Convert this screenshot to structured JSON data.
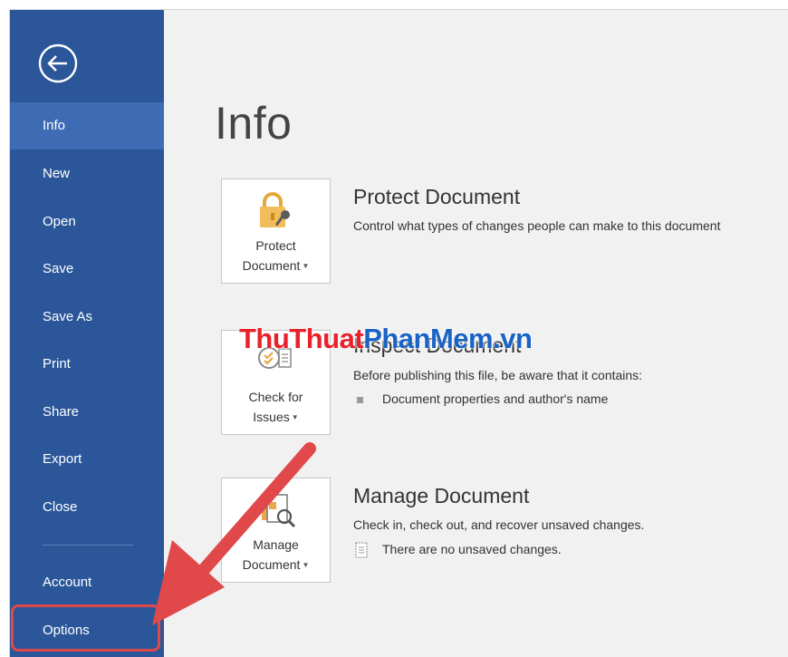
{
  "sidebar": {
    "items": [
      {
        "label": "Info"
      },
      {
        "label": "New"
      },
      {
        "label": "Open"
      },
      {
        "label": "Save"
      },
      {
        "label": "Save As"
      },
      {
        "label": "Print"
      },
      {
        "label": "Share"
      },
      {
        "label": "Export"
      },
      {
        "label": "Close"
      },
      {
        "label": "Account"
      },
      {
        "label": "Options"
      }
    ],
    "active": "Info",
    "highlighted": "Options"
  },
  "page_title": "Info",
  "sections": {
    "protect": {
      "tile_line1": "Protect",
      "tile_line2": "Document",
      "title": "Protect Document",
      "description": "Control what types of changes people can make to this document"
    },
    "inspect": {
      "tile_line1": "Check for",
      "tile_line2": "Issues",
      "title": "Inspect Document",
      "description": "Before publishing this file, be aware that it contains:",
      "bullet": "Document properties and author's name"
    },
    "manage": {
      "tile_line1": "Manage",
      "tile_line2": "Document",
      "title": "Manage Document",
      "description": "Check in, check out, and recover unsaved changes.",
      "bullet": "There are no unsaved changes."
    }
  },
  "watermark": {
    "part_red": "ThuThuat",
    "part_blue": "PhanMem",
    "part_red2": ".vn"
  },
  "icons": {
    "back": "back-arrow-icon",
    "protect": "lock-key-icon",
    "inspect": "inspect-checklist-icon",
    "manage": "manage-document-icon",
    "dropdown": "caret-down-icon",
    "bullet": "bullet-square-icon",
    "doc": "document-icon"
  },
  "colors": {
    "sidebar": "#2b579a",
    "sidebar_active": "#3d6cb5",
    "content_bg": "#f1f1f1",
    "annotation_red": "#e0484a"
  }
}
